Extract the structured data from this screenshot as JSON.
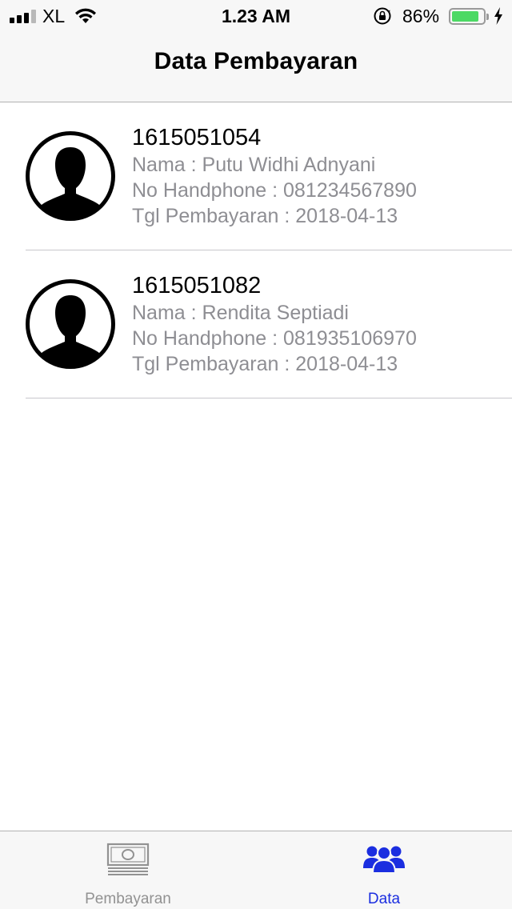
{
  "status_bar": {
    "carrier": "XL",
    "time": "1.23 AM",
    "battery_percent": "86%",
    "battery_level": 0.86,
    "battery_color": "#4cd964"
  },
  "nav": {
    "title": "Data Pembayaran"
  },
  "payments": [
    {
      "id": "1615051054",
      "nama": "Nama : Putu Widhi Adnyani",
      "phone": "No Handphone : 081234567890",
      "tanggal": "Tgl Pembayaran : 2018-04-13",
      "icon": "person-silhouette-icon"
    },
    {
      "id": "1615051082",
      "nama": "Nama : Rendita Septiadi",
      "phone": "No Handphone : 081935106970",
      "tanggal": "Tgl Pembayaran : 2018-04-13",
      "icon": "person-silhouette-icon"
    }
  ],
  "tab_bar": {
    "tabs": [
      {
        "label": "Pembayaran",
        "icon": "money-bill-icon",
        "active": false
      },
      {
        "label": "Data",
        "icon": "people-group-icon",
        "active": true
      }
    ],
    "active_color": "#1b2ee0",
    "inactive_color": "#929292"
  }
}
